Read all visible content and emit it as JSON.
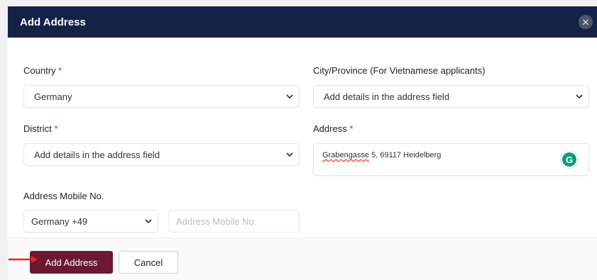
{
  "modal": {
    "title": "Add Address",
    "close_glyph": "✕",
    "close_icon": "close-icon"
  },
  "form": {
    "country": {
      "label": "Country",
      "required_mark": "*",
      "value": "Germany"
    },
    "city": {
      "label": "City/Province (For Vietnamese applicants)",
      "value": "Add details in the address field"
    },
    "district": {
      "label": "District",
      "required_mark": "*",
      "value": "Add details in the address field"
    },
    "address": {
      "label": "Address",
      "required_mark": "*",
      "value_word": "Grabengasse",
      "value_rest": " 5, 69117 Heidelberg",
      "assistant_icon": "grammarly-icon",
      "assistant_glyph": "G"
    },
    "mobile": {
      "label": "Address Mobile No.",
      "country_code": "Germany +49",
      "placeholder": "Address Mobile No."
    }
  },
  "footer": {
    "submit_label": "Add Address",
    "cancel_label": "Cancel"
  },
  "colors": {
    "header_bg": "#162146",
    "primary_button": "#6b1830",
    "required": "#e02a2a",
    "annotation_arrow": "#e3262b"
  }
}
